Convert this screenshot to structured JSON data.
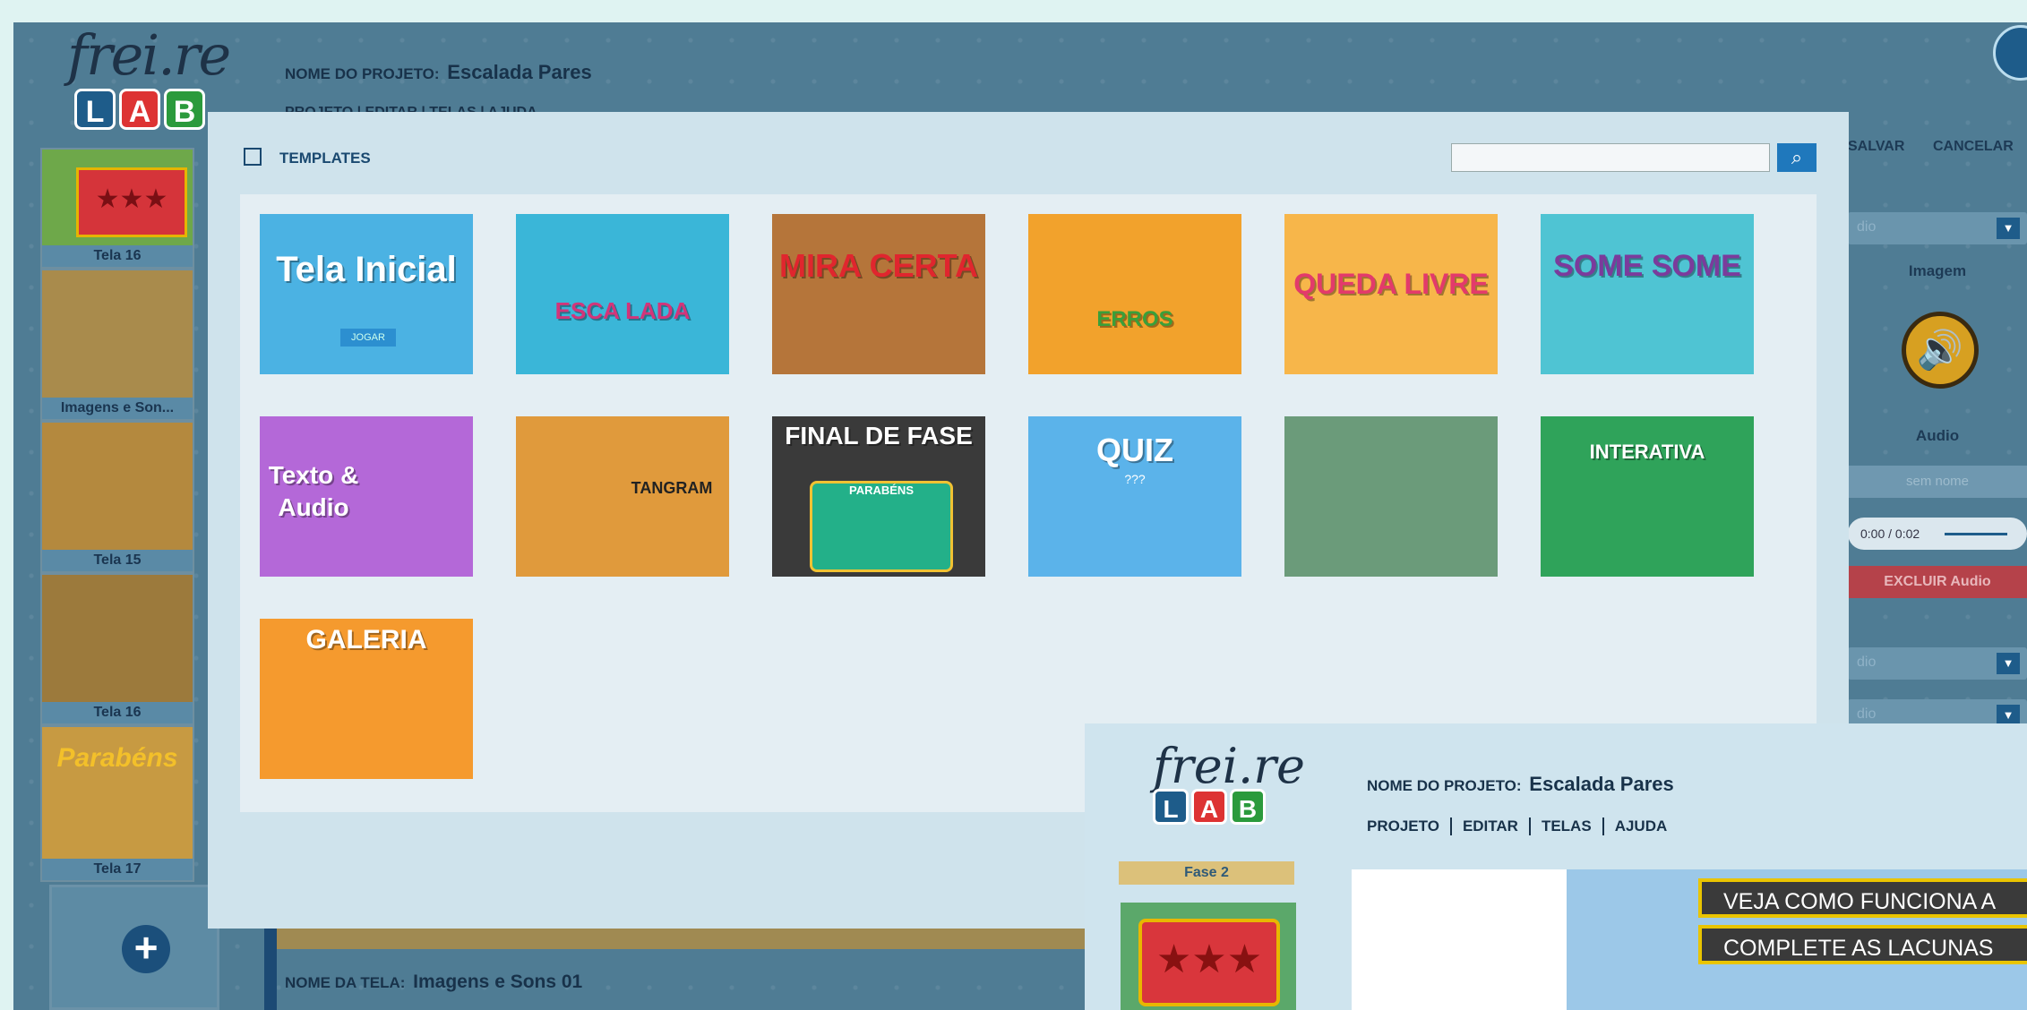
{
  "app": {
    "logo_script": "frei.re",
    "logo_letters": [
      "L",
      "A",
      "B"
    ],
    "project_label": "NOME DO PROJETO:",
    "project_name": "Escalada Pares",
    "menu": [
      "PROJETO",
      "EDITAR",
      "TELAS",
      "AJUDA"
    ],
    "sidebar_thumbs": [
      {
        "caption": "Tela 16"
      },
      {
        "caption": "Imagens e Son..."
      },
      {
        "caption": "Tela 15"
      },
      {
        "caption": "Tela 16"
      },
      {
        "caption": "Tela 17",
        "title": "Parabéns"
      }
    ],
    "screen_label": "NOME DA TELA:",
    "screen_name": "Imagens e Sons 01"
  },
  "right_panel": {
    "save": "SALVAR",
    "cancel": "CANCELAR",
    "select_audio": "dio",
    "image_title": "Imagem",
    "audio_title": "Audio",
    "no_name": "sem nome",
    "time": "0:00 / 0:02",
    "delete_audio": "EXCLUIR Audio",
    "select_2": "dio",
    "select_3": "dio"
  },
  "modal": {
    "title": "TEMPLATES",
    "search_placeholder": "",
    "templates": [
      {
        "label": "Tela Inicial",
        "sub": "JOGAR",
        "color": "#4bb2e3"
      },
      {
        "label": "ESCA LADA",
        "color": "#3ab6d8"
      },
      {
        "label": "MIRA CERTA",
        "color": "#b5753a"
      },
      {
        "label": "ERROS",
        "color": "#f2a22c"
      },
      {
        "label": "QUEDA LIVRE",
        "color": "#f7b64a"
      },
      {
        "label": "SOME SOME",
        "color": "#4fc4d3"
      },
      {
        "label": "Texto & Audio",
        "color": "#b468d8"
      },
      {
        "label": "TANGRAM",
        "color": "#e09a3c"
      },
      {
        "label": "FINAL DE FASE",
        "sub": "PARABÉNS",
        "color": "#3a3a3a"
      },
      {
        "label": "QUIZ",
        "sub": "???",
        "color": "#5bb3ea"
      },
      {
        "label": "",
        "color": "#6b9b7a"
      },
      {
        "label": "INTERATIVA",
        "color": "#2fa35a"
      },
      {
        "label": "GALERIA",
        "color": "#f59a2e"
      }
    ]
  },
  "inset": {
    "logo_script": "frei.re",
    "logo_letters": [
      "L",
      "A",
      "B"
    ],
    "project_label": "NOME DO PROJETO:",
    "project_name": "Escalada Pares",
    "menu": [
      "PROJETO",
      "EDITAR",
      "TELAS",
      "AJUDA"
    ],
    "phase": "Fase 2",
    "banner_1": "VEJA COMO FUNCIONA A",
    "banner_2": "COMPLETE AS LACUNAS"
  }
}
